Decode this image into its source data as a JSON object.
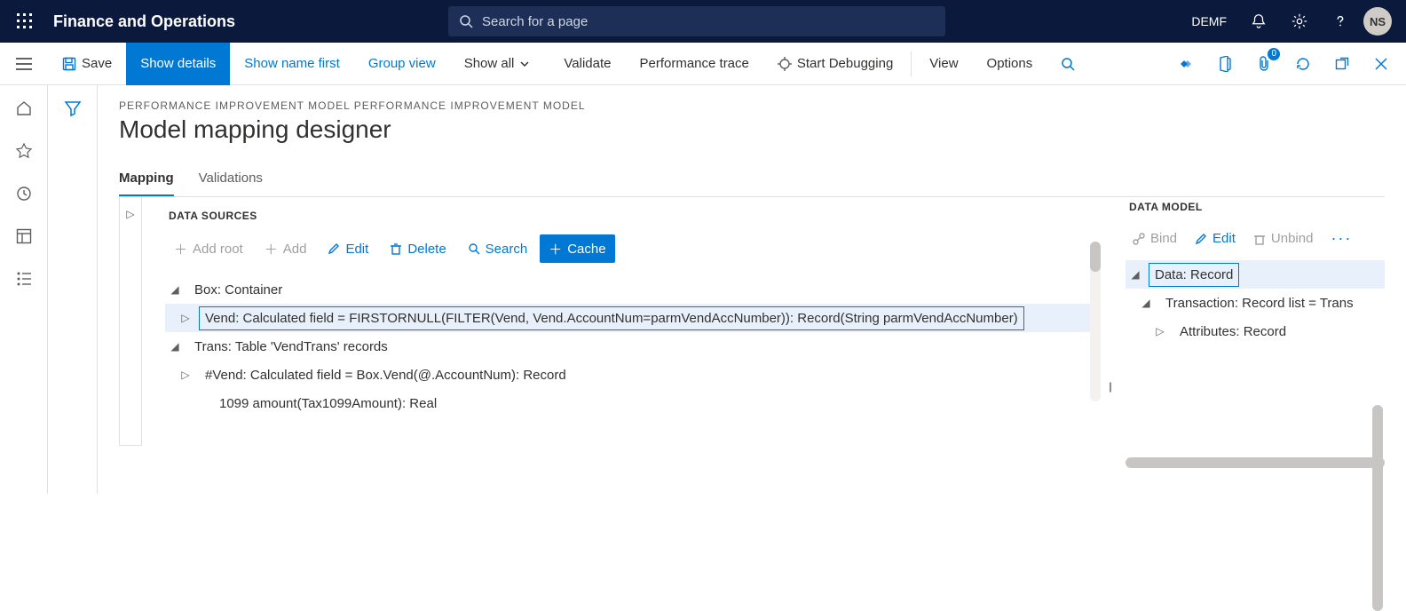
{
  "top": {
    "brand": "Finance and Operations",
    "search_placeholder": "Search for a page",
    "company": "DEMF",
    "avatar": "NS"
  },
  "bar": {
    "save": "Save",
    "show_details": "Show details",
    "show_name_first": "Show name first",
    "group_view": "Group view",
    "show_all": "Show all",
    "validate": "Validate",
    "perf_trace": "Performance trace",
    "debug": "Start Debugging",
    "view": "View",
    "options": "Options",
    "attach_badge": "0"
  },
  "page": {
    "breadcrumb": "PERFORMANCE IMPROVEMENT MODEL PERFORMANCE IMPROVEMENT MODEL",
    "title": "Model mapping designer"
  },
  "tabs": {
    "mapping": "Mapping",
    "validations": "Validations"
  },
  "ds": {
    "heading": "DATA SOURCES",
    "add_root": "Add root",
    "add": "Add",
    "edit": "Edit",
    "delete": "Delete",
    "search": "Search",
    "cache": "Cache",
    "rows": {
      "r0": "Box: Container",
      "r1": "Vend: Calculated field = FIRSTORNULL(FILTER(Vend, Vend.AccountNum=parmVendAccNumber)): Record(String parmVendAccNumber)",
      "r2": "Trans: Table 'VendTrans' records",
      "r3": "#Vend: Calculated field = Box.Vend(@.AccountNum): Record",
      "r4": "1099 amount(Tax1099Amount): Real"
    }
  },
  "dm": {
    "heading": "DATA MODEL",
    "bind": "Bind",
    "edit": "Edit",
    "unbind": "Unbind",
    "rows": {
      "r0": "Data: Record",
      "r1": "Transaction: Record list = Trans",
      "r2": "Attributes: Record"
    }
  }
}
